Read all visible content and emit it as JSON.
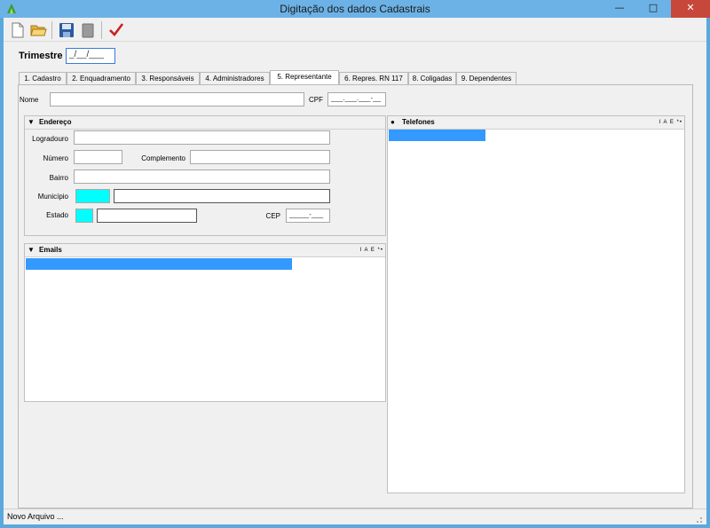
{
  "window": {
    "title": "Digitação dos dados Cadastrais",
    "minimize_label": "—",
    "maximize_label": "□",
    "close_label": "✕"
  },
  "toolbar": {
    "new_icon": "new-document-icon",
    "open_icon": "open-folder-icon",
    "save_icon": "save-disk-icon",
    "delete_icon": "trash-icon",
    "confirm_icon": "checkmark-icon",
    "confirm_color": "#cc1f1f"
  },
  "trimestre": {
    "label": "Trimestre",
    "value": "_/__/___"
  },
  "tabs": [
    {
      "label": "1. Cadastro"
    },
    {
      "label": "2. Enquadramento"
    },
    {
      "label": "3. Responsáveis"
    },
    {
      "label": "4. Administradores"
    },
    {
      "label": "5. Representante"
    },
    {
      "label": "6. Repres. RN 117"
    },
    {
      "label": "8. Coligadas"
    },
    {
      "label": "9. Dependentes"
    }
  ],
  "representante": {
    "nome_label": "Nome",
    "nome_value": "",
    "cpf_label": "CPF",
    "cpf_value": "___.___.___-__"
  },
  "endereco": {
    "title": "Endereço",
    "logradouro_label": "Logradouro",
    "numero_label": "Número",
    "complemento_label": "Complemento",
    "bairro_label": "Bairro",
    "municipio_label": "Município",
    "estado_label": "Estado",
    "cep_label": "CEP",
    "cep_value": "_____-___"
  },
  "emails": {
    "title": "Emails",
    "buttons": "I A E *•"
  },
  "telefones": {
    "title": "Telefones",
    "buttons": "I A E *•"
  },
  "status": {
    "text": "Novo Arquivo ..."
  },
  "colors": {
    "accent": "#3399ff",
    "lookup": "#00ffff",
    "titlebar": "#6cb2e6",
    "close": "#c7473a"
  }
}
